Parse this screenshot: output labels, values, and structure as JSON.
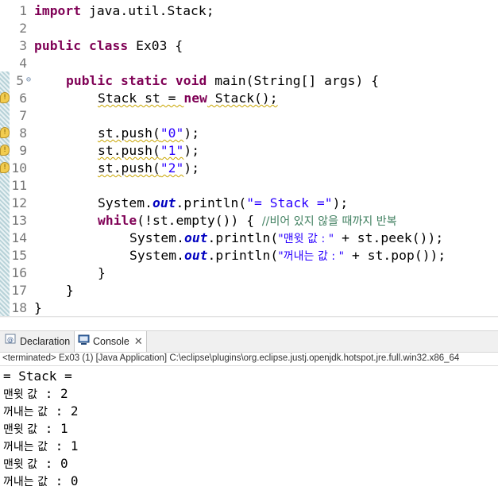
{
  "editor": {
    "lines": [
      {
        "num": "1"
      },
      {
        "num": "2"
      },
      {
        "num": "3"
      },
      {
        "num": "4"
      },
      {
        "num": "5"
      },
      {
        "num": "6"
      },
      {
        "num": "7"
      },
      {
        "num": "8"
      },
      {
        "num": "9"
      },
      {
        "num": "10"
      },
      {
        "num": "11"
      },
      {
        "num": "12"
      },
      {
        "num": "13"
      },
      {
        "num": "14"
      },
      {
        "num": "15"
      },
      {
        "num": "16"
      },
      {
        "num": "17"
      },
      {
        "num": "18"
      }
    ],
    "code": {
      "l1_kw": "import",
      "l1_rest": " java.util.Stack;",
      "l3_kw": "public class",
      "l3_rest": " Ex03 {",
      "l5_kw": "public static void",
      "l5_rest": " main(String[] args) {",
      "l6_a": "Stack st = ",
      "l6_kw": "new",
      "l6_b": " Stack();",
      "l8_a": "st.push(",
      "l8_str": "\"0\"",
      "l8_b": ");",
      "l9_a": "st.push(",
      "l9_str": "\"1\"",
      "l9_b": ");",
      "l10_a": "st.push(",
      "l10_str": "\"2\"",
      "l10_b": ");",
      "l12_a": "System.",
      "l12_fld": "out",
      "l12_b": ".println(",
      "l12_str": "\"= Stack =\"",
      "l12_c": ");",
      "l13_kw": "while",
      "l13_a": "(!st.empty()) { ",
      "l13_cmt": "//비어 있지 않을 때까지 반복",
      "l14_a": "System.",
      "l14_fld": "out",
      "l14_b": ".println(",
      "l14_str": "\"맨윗 값 : \"",
      "l14_c": " + st.peek());",
      "l15_a": "System.",
      "l15_fld": "out",
      "l15_b": ".println(",
      "l15_str": "\"꺼내는 값 : \"",
      "l15_c": " + st.pop());",
      "l16": "}",
      "l17": "}",
      "l18": "}"
    }
  },
  "tabs": {
    "declaration": "Declaration",
    "console": "Console"
  },
  "console": {
    "status": "<terminated> Ex03 (1) [Java Application] C:\\eclipse\\plugins\\org.eclipse.justj.openjdk.hotspot.jre.full.win32.x86_64",
    "output": [
      {
        "text": "= Stack ="
      },
      {
        "label": "맨윗 값",
        "value": " : 2"
      },
      {
        "label": "꺼내는 값",
        "value": " : 2"
      },
      {
        "label": "맨윗 값",
        "value": " : 1"
      },
      {
        "label": "꺼내는 값",
        "value": " : 1"
      },
      {
        "label": "맨윗 값",
        "value": " : 0"
      },
      {
        "label": "꺼내는 값",
        "value": " : 0"
      }
    ]
  },
  "colors": {
    "keyword": "#7f0055",
    "string": "#2a00ff",
    "field": "#0000c0",
    "comment": "#3f7f5f",
    "line_number": "#787878"
  }
}
